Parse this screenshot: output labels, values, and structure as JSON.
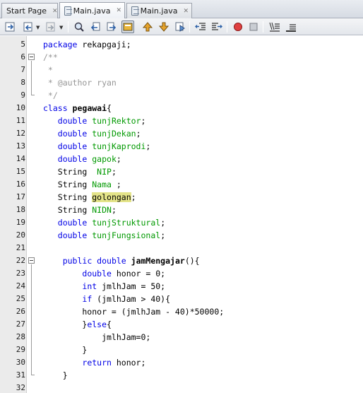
{
  "tabs": [
    {
      "label": "Start Page",
      "close": "✕",
      "active": false
    },
    {
      "label": "Main.java",
      "close": "✕",
      "active": true
    },
    {
      "label": "Main.java",
      "close": "✕",
      "active": false
    }
  ],
  "toolbar": {
    "icons": [
      "last-edit-icon",
      "back-icon",
      "forward-icon",
      "find-icon",
      "find-previous-icon",
      "find-next-icon",
      "toggle-highlight-icon",
      "previous-bookmark-icon",
      "next-bookmark-icon",
      "toggle-bookmark-icon",
      "shift-left-icon",
      "shift-right-icon",
      "start-macro-icon",
      "stop-macro-icon",
      "comment-icon",
      "uncomment-icon"
    ]
  },
  "editor": {
    "line_numbers": [
      "5",
      "6",
      "7",
      "8",
      "9",
      "10",
      "11",
      "12",
      "13",
      "14",
      "15",
      "16",
      "17",
      "18",
      "19",
      "20",
      "21",
      "22",
      "23",
      "24",
      "25",
      "26",
      "27",
      "28",
      "29",
      "30",
      "31",
      "32"
    ],
    "lines": [
      {
        "num": "5",
        "tokens": [
          [
            "kw",
            "package "
          ],
          [
            "pl",
            "rekapgaji;"
          ]
        ]
      },
      {
        "num": "6",
        "tokens": [
          [
            "cm",
            "/**"
          ]
        ]
      },
      {
        "num": "7",
        "tokens": [
          [
            "cm",
            " *"
          ]
        ]
      },
      {
        "num": "8",
        "tokens": [
          [
            "cm",
            " * @author ryan"
          ]
        ]
      },
      {
        "num": "9",
        "tokens": [
          [
            "cm",
            " */"
          ]
        ]
      },
      {
        "num": "10",
        "tokens": [
          [
            "kw",
            "class "
          ],
          [
            "mth",
            "pegawai"
          ],
          [
            "pl",
            "{"
          ]
        ]
      },
      {
        "num": "11",
        "tokens": [
          [
            "pl",
            "   "
          ],
          [
            "kw",
            "double "
          ],
          [
            "fld",
            "tunjRektor"
          ],
          [
            "pl",
            ";"
          ]
        ]
      },
      {
        "num": "12",
        "tokens": [
          [
            "pl",
            "   "
          ],
          [
            "kw",
            "double "
          ],
          [
            "fld",
            "tunjDekan"
          ],
          [
            "pl",
            ";"
          ]
        ]
      },
      {
        "num": "13",
        "tokens": [
          [
            "pl",
            "   "
          ],
          [
            "kw",
            "double "
          ],
          [
            "fld",
            "tunjKaprodi"
          ],
          [
            "pl",
            ";"
          ]
        ]
      },
      {
        "num": "14",
        "tokens": [
          [
            "pl",
            "   "
          ],
          [
            "kw",
            "double "
          ],
          [
            "fld",
            "gapok"
          ],
          [
            "pl",
            ";"
          ]
        ]
      },
      {
        "num": "15",
        "tokens": [
          [
            "pl",
            "   String  "
          ],
          [
            "fld",
            "NIP"
          ],
          [
            "pl",
            ";"
          ]
        ]
      },
      {
        "num": "16",
        "tokens": [
          [
            "pl",
            "   String "
          ],
          [
            "fld",
            "Nama"
          ],
          [
            "pl",
            " ;"
          ]
        ]
      },
      {
        "num": "17",
        "tokens": [
          [
            "pl",
            "   String "
          ],
          [
            "hl",
            "golongan"
          ],
          [
            "pl",
            ";"
          ]
        ]
      },
      {
        "num": "18",
        "tokens": [
          [
            "pl",
            "   String "
          ],
          [
            "fld",
            "NIDN"
          ],
          [
            "pl",
            ";"
          ]
        ]
      },
      {
        "num": "19",
        "tokens": [
          [
            "pl",
            "   "
          ],
          [
            "kw",
            "double "
          ],
          [
            "fld",
            "tunjStruktural"
          ],
          [
            "pl",
            ";"
          ]
        ]
      },
      {
        "num": "20",
        "tokens": [
          [
            "pl",
            "   "
          ],
          [
            "kw",
            "double "
          ],
          [
            "fld",
            "tunjFungsional"
          ],
          [
            "pl",
            ";"
          ]
        ]
      },
      {
        "num": "21",
        "tokens": [
          [
            "pl",
            ""
          ]
        ]
      },
      {
        "num": "22",
        "tokens": [
          [
            "pl",
            "    "
          ],
          [
            "kw",
            "public double "
          ],
          [
            "mth",
            "jamMengajar"
          ],
          [
            "pl",
            "(){"
          ]
        ]
      },
      {
        "num": "23",
        "tokens": [
          [
            "pl",
            "        "
          ],
          [
            "kw",
            "double "
          ],
          [
            "pl",
            "honor = 0;"
          ]
        ]
      },
      {
        "num": "24",
        "tokens": [
          [
            "pl",
            "        "
          ],
          [
            "kw",
            "int "
          ],
          [
            "pl",
            "jmlhJam = 50;"
          ]
        ]
      },
      {
        "num": "25",
        "tokens": [
          [
            "pl",
            "        "
          ],
          [
            "kw",
            "if "
          ],
          [
            "pl",
            "(jmlhJam > 40){"
          ]
        ]
      },
      {
        "num": "26",
        "tokens": [
          [
            "pl",
            "        honor = (jmlhJam - 40)*50000;"
          ]
        ]
      },
      {
        "num": "27",
        "tokens": [
          [
            "pl",
            "        }"
          ],
          [
            "kw",
            "else"
          ],
          [
            "pl",
            "{"
          ]
        ]
      },
      {
        "num": "28",
        "tokens": [
          [
            "pl",
            "            jmlhJam=0;"
          ]
        ]
      },
      {
        "num": "29",
        "tokens": [
          [
            "pl",
            "        }"
          ]
        ]
      },
      {
        "num": "30",
        "tokens": [
          [
            "pl",
            "        "
          ],
          [
            "kw",
            "return "
          ],
          [
            "pl",
            "honor;"
          ]
        ]
      },
      {
        "num": "31",
        "tokens": [
          [
            "pl",
            "    }"
          ]
        ]
      },
      {
        "num": "32",
        "tokens": [
          [
            "pl",
            ""
          ]
        ]
      }
    ]
  },
  "colors": {
    "keyword": "#0000e6",
    "comment": "#969696",
    "field": "#009900",
    "highlight": "#e4e489",
    "gutter": "#ebebeb"
  }
}
